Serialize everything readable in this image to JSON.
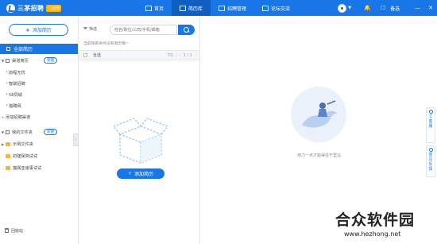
{
  "app": {
    "name": "三茅招聘",
    "badge": "公测版"
  },
  "nav": [
    {
      "label": "首页",
      "icon": "home-icon",
      "active": false
    },
    {
      "label": "简历库",
      "icon": "mail-icon",
      "active": true
    },
    {
      "label": "招聘管理",
      "icon": "doc-icon",
      "active": false
    },
    {
      "label": "论坛交流",
      "icon": "chat-icon",
      "active": false
    }
  ],
  "topright": {
    "bell": "🔔",
    "bookmark_label": "备选",
    "minimize": "—",
    "close": "✕"
  },
  "left": {
    "add_resume_label": "添加简历",
    "all_resumes": "全部简历",
    "channels": {
      "label": "渠道简历",
      "tag": "管理"
    },
    "channel_items": [
      "前程无忧",
      "智联招聘",
      "58同城",
      "猎聘网"
    ],
    "add_channel": "添加招聘渠道",
    "my_folders": {
      "label": "我的文件夹",
      "tag": "新建"
    },
    "folder_items": [
      "示例文件夹",
      "初建保简试试",
      "猫属亚速事试试"
    ],
    "recycle": "回收站"
  },
  "middle": {
    "filter_label": "筛选",
    "search_placeholder": "姓名/职位/公司/手机/邮箱",
    "hint": "当前搜索条件没有简历哦~",
    "select_all": "全选",
    "sort_label": "TD",
    "page": "1 / 1",
    "add_resume_label": "添加简历"
  },
  "right": {
    "empty_text": "用力一点才能得住干里马"
  },
  "sidebar": {
    "feedback": "工\n客\n服",
    "help": "意\n见\n反\n馈"
  },
  "watermark": {
    "title": "合众软件园",
    "url": "www.hezhong.net"
  },
  "colors": {
    "primary": "#1976e6",
    "folder": "#f5b532"
  }
}
